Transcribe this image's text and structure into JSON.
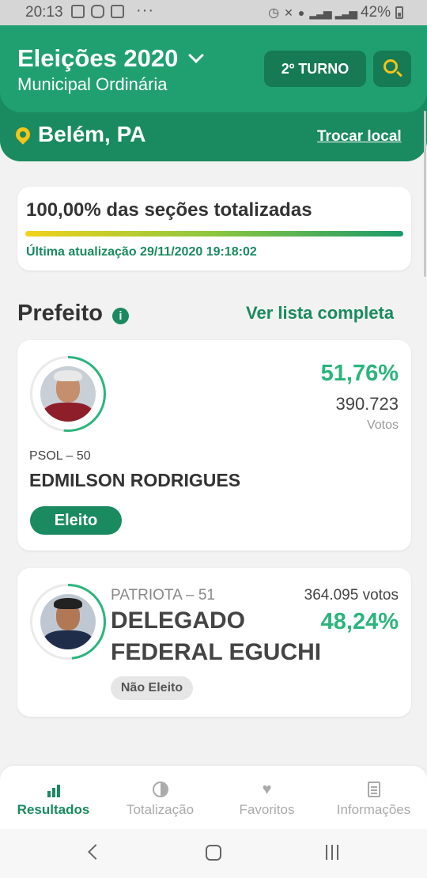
{
  "status_bar": {
    "time": "20:13",
    "dots": "···",
    "battery": "42%"
  },
  "header": {
    "title": "Eleições 2020",
    "subtitle": "Municipal Ordinária",
    "turno_label": "2º TURNO",
    "location": "Belém, PA",
    "change_location": "Trocar local"
  },
  "progress": {
    "title": "100,00% das seções totalizadas",
    "fraction": 1.0,
    "updated": "Última atualização 29/11/2020 19:18:02"
  },
  "section": {
    "title": "Prefeito",
    "info_icon": "i",
    "link": "Ver lista completa"
  },
  "candidates": [
    {
      "party": "PSOL – 50",
      "name": "EDMILSON RODRIGUES",
      "percent": "51,76%",
      "votes": "390.723",
      "votes_label": "Votos",
      "status": "Eleito",
      "share": 0.5176
    },
    {
      "party": "PATRIOTA – 51",
      "name_line1": "DELEGADO",
      "name_line2": "FEDERAL EGUCHI",
      "percent": "48,24%",
      "votes": "364.095 votos",
      "status": "Não Eleito",
      "share": 0.4824
    }
  ],
  "bottom_nav": [
    {
      "label": "Resultados",
      "icon": "bar-chart-icon",
      "active": true
    },
    {
      "label": "Totalização",
      "icon": "pie-chart-icon",
      "active": false
    },
    {
      "label": "Favoritos",
      "icon": "heart-icon",
      "active": false
    },
    {
      "label": "Informações",
      "icon": "document-icon",
      "active": false
    }
  ],
  "colors": {
    "primary": "#20a070",
    "primary_dark": "#1a8a60",
    "accent": "#f5c518",
    "percent_green": "#2bb57c"
  }
}
